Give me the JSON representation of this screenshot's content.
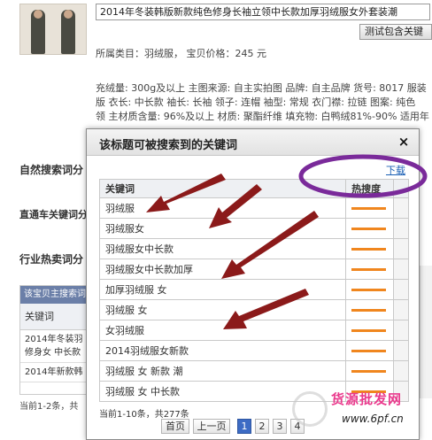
{
  "product": {
    "title": "2014年冬装韩版新款纯色修身长袖立领中长款加厚羽绒服女外套装潮",
    "test_button": "测试包含关键",
    "category_label": "所属类目：",
    "category_value": "羽绒服",
    "price_label": "宝贝价格：",
    "price_value": "245 元",
    "attr_lines": [
      "充绒量: 300g及以上  主图来源: 自主实拍图  品牌: 自主品牌  货号: 8017  服装",
      "版  衣长: 中长款  袖长: 长袖  领子: 连帽  袖型: 常规  衣门襟: 拉链  图案: 纯色",
      "领  主材质含量: 96%及以上  材质: 聚酯纤维  填充物: 白鸭绒81%-90%  适用年"
    ]
  },
  "side_sections": {
    "natural_search": "自然搜索词分",
    "express_keywords": "直通车关键词分",
    "industry_hot": "行业热卖词分"
  },
  "left_table": {
    "header": "该宝贝主搜索词",
    "column": "关键词",
    "rows": [
      "2014年冬装羽",
      "修身女 中长款",
      "2014年新款韩"
    ],
    "footer": "当前1-2条，共"
  },
  "dialog": {
    "title": "该标题可被搜索到的关键词",
    "close": "×",
    "download": "下载",
    "col_keyword": "关键词",
    "col_hot": "热搜度",
    "rows": [
      {
        "keyword": "羽绒服",
        "heat": 0.85
      },
      {
        "keyword": "羽绒服女",
        "heat": 0.85
      },
      {
        "keyword": "羽绒服女中长款",
        "heat": 0.85
      },
      {
        "keyword": "羽绒服女中长款加厚",
        "heat": 0.85
      },
      {
        "keyword": "加厚羽绒服 女",
        "heat": 0.85
      },
      {
        "keyword": "羽绒服 女",
        "heat": 0.85
      },
      {
        "keyword": "女羽绒服",
        "heat": 0.85
      },
      {
        "keyword": "2014羽绒服女新款",
        "heat": 0.85
      },
      {
        "keyword": "羽绒服 女 新款 潮",
        "heat": 0.85
      },
      {
        "keyword": "羽绒服 女 中长款",
        "heat": 0.85
      }
    ],
    "pager_info": "当前1-10条，共277条",
    "pager": {
      "first": "首页",
      "prev": "上一页",
      "pages": [
        "1",
        "2",
        "3",
        "4"
      ],
      "current": "1"
    }
  },
  "watermark": {
    "brand": "货源批发网",
    "url": "www.6pf.cn"
  },
  "colors": {
    "heat_bar": "#f0861e",
    "arrow": "#8b1a1a",
    "highlight_ellipse": "#7a2a9a",
    "link": "#1a5fb4",
    "active_page": "#3d6bc4"
  }
}
